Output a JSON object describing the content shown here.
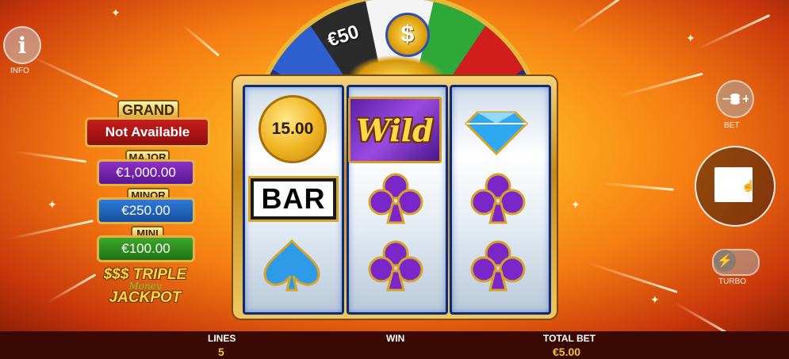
{
  "left_controls": {
    "info_icon": "i",
    "info_label": "INFO"
  },
  "jackpots": {
    "grand": {
      "title": "GRAND",
      "value": "Not Available"
    },
    "major": {
      "title": "MAJOR",
      "value": "€1,000.00"
    },
    "minor": {
      "title": "MINOR",
      "value": "€250.00"
    },
    "mini": {
      "title": "MINI",
      "value": "€100.00"
    }
  },
  "logo": {
    "line1": "$$$ TRIPLE",
    "line2": "Money",
    "line3": "JACKPOT"
  },
  "wheel": {
    "segments": [
      "€50",
      "$"
    ]
  },
  "reels": {
    "reel1": [
      "coin",
      "bar",
      "spade"
    ],
    "reel2": [
      "wild",
      "club",
      "club"
    ],
    "reel3": [
      "diamond",
      "club",
      "club"
    ],
    "coin_value": "15.00",
    "bar_label": "BAR",
    "wild_label": "Wild"
  },
  "right_controls": {
    "bet_label": "BET",
    "turbo_label": "TURBO"
  },
  "bottom_bar": {
    "lines_label": "LINES",
    "lines_value": "5",
    "win_label": "WIN",
    "total_bet_label": "TOTAL BET",
    "total_bet_value": "€5.00"
  },
  "colors": {
    "accent_gold": "#f2c12e",
    "grand": "#c81d1d",
    "major": "#8b32c7",
    "minor": "#2f7ad9",
    "mini": "#3ea62a"
  }
}
